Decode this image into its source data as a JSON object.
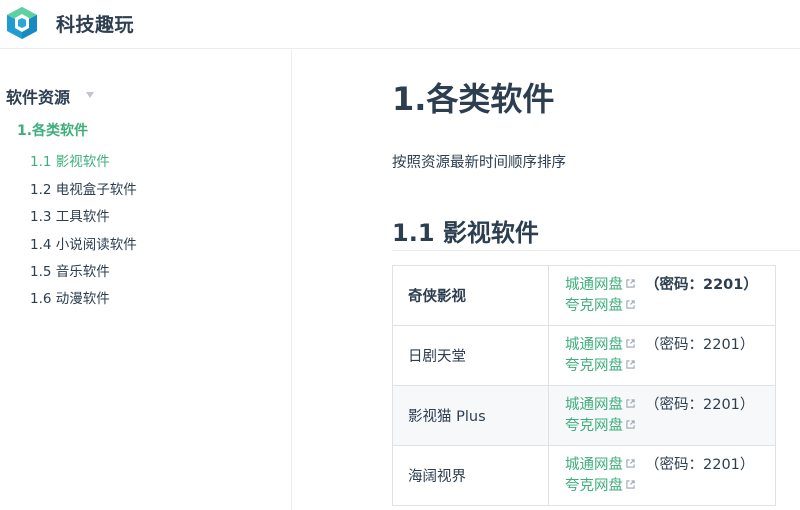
{
  "header": {
    "site_title": "科技趣玩"
  },
  "sidebar": {
    "group_title": "软件资源",
    "section": "1.各类软件",
    "items": [
      {
        "label": "1.1 影视软件",
        "active": true
      },
      {
        "label": "1.2 电视盒子软件",
        "active": false
      },
      {
        "label": "1.3 工具软件",
        "active": false
      },
      {
        "label": "1.4 小说阅读软件",
        "active": false
      },
      {
        "label": "1.5 音乐软件",
        "active": false
      },
      {
        "label": "1.6 动漫软件",
        "active": false
      }
    ]
  },
  "content": {
    "title": "1.各类软件",
    "intro": "按照资源最新时间顺序排序",
    "subtitle": "1.1 影视软件",
    "table": [
      {
        "name": "奇侠影视",
        "link1": "城通网盘",
        "password": "（密码：2201）",
        "link2": "夸克网盘"
      },
      {
        "name": "日剧天堂",
        "link1": "城通网盘",
        "password": "（密码：2201）",
        "link2": "夸克网盘"
      },
      {
        "name": "影视猫 Plus",
        "link1": "城通网盘",
        "password": "（密码：2201）",
        "link2": "夸克网盘"
      },
      {
        "name": "海阔视界",
        "link1": "城通网盘",
        "password": "（密码：2201）",
        "link2": "夸克网盘"
      }
    ]
  },
  "colors": {
    "accent": "#3eaf7c",
    "text": "#2c3e50",
    "border": "#dfe2e5"
  },
  "icons": {
    "logo": "cube-logo-icon",
    "external": "external-link-icon",
    "caret": "caret-down-icon"
  }
}
